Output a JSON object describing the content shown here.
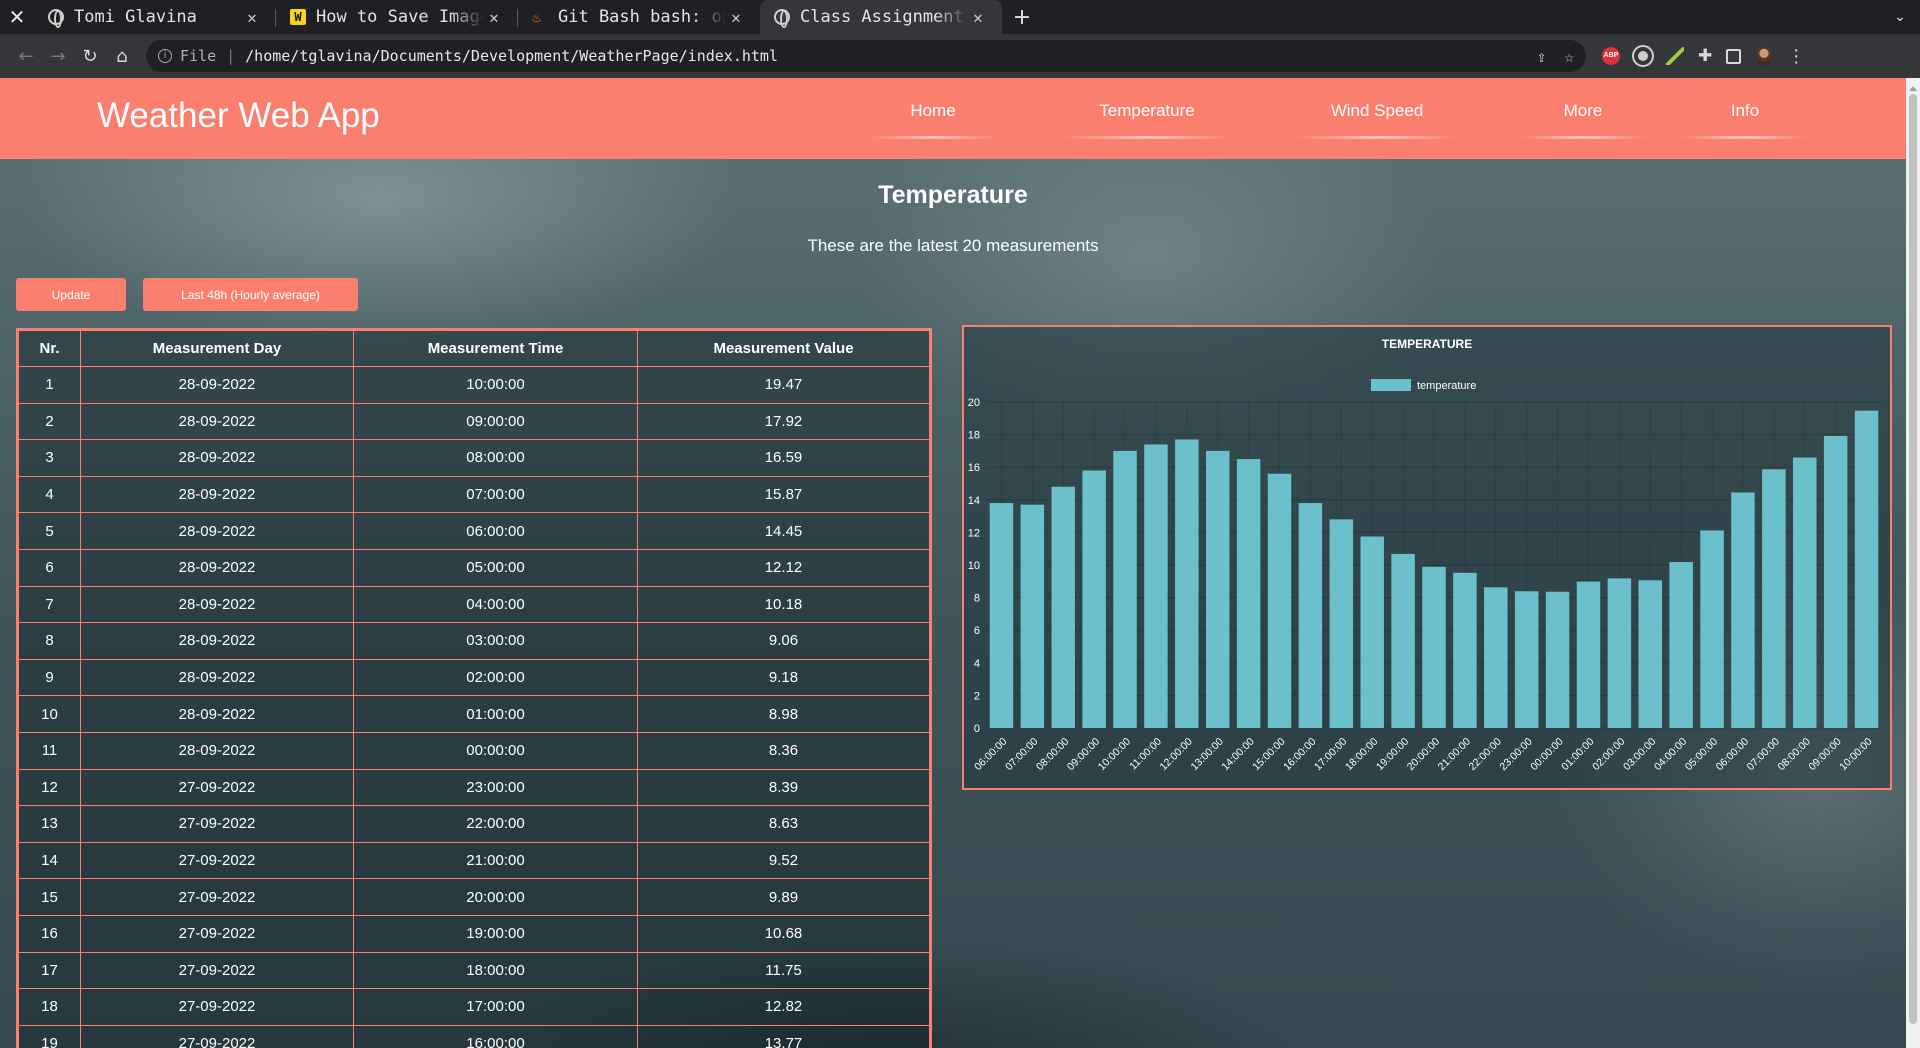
{
  "browser": {
    "tabs": [
      {
        "title": "Tomi Glavina",
        "icon": "globe-icon",
        "active": false
      },
      {
        "title": "How to Save Images",
        "icon": "w-favicon-icon",
        "active": false
      },
      {
        "title": "Git Bash bash: ope",
        "icon": "git-bash-icon",
        "active": false
      },
      {
        "title": "Class Assignment",
        "icon": "globe-icon",
        "active": true
      }
    ],
    "scheme": "File",
    "url": "/home/tglavina/Documents/Development/WeatherPage/index.html"
  },
  "header": {
    "brand": "Weather Web App",
    "nav": [
      "Home",
      "Temperature",
      "Wind Speed",
      "More",
      "Info"
    ]
  },
  "main": {
    "title": "Temperature",
    "subtitle": "These are the latest 20 measurements",
    "buttons": {
      "update": "Update",
      "last48": "Last 48h (Hourly average)"
    }
  },
  "table": {
    "headers": [
      "Nr.",
      "Measurement Day",
      "Measurement Time",
      "Measurement Value"
    ],
    "rows": [
      [
        "1",
        "28-09-2022",
        "10:00:00",
        "19.47"
      ],
      [
        "2",
        "28-09-2022",
        "09:00:00",
        "17.92"
      ],
      [
        "3",
        "28-09-2022",
        "08:00:00",
        "16.59"
      ],
      [
        "4",
        "28-09-2022",
        "07:00:00",
        "15.87"
      ],
      [
        "5",
        "28-09-2022",
        "06:00:00",
        "14.45"
      ],
      [
        "6",
        "28-09-2022",
        "05:00:00",
        "12.12"
      ],
      [
        "7",
        "28-09-2022",
        "04:00:00",
        "10.18"
      ],
      [
        "8",
        "28-09-2022",
        "03:00:00",
        "9.06"
      ],
      [
        "9",
        "28-09-2022",
        "02:00:00",
        "9.18"
      ],
      [
        "10",
        "28-09-2022",
        "01:00:00",
        "8.98"
      ],
      [
        "11",
        "28-09-2022",
        "00:00:00",
        "8.36"
      ],
      [
        "12",
        "27-09-2022",
        "23:00:00",
        "8.39"
      ],
      [
        "13",
        "27-09-2022",
        "22:00:00",
        "8.63"
      ],
      [
        "14",
        "27-09-2022",
        "21:00:00",
        "9.52"
      ],
      [
        "15",
        "27-09-2022",
        "20:00:00",
        "9.89"
      ],
      [
        "16",
        "27-09-2022",
        "19:00:00",
        "10.68"
      ],
      [
        "17",
        "27-09-2022",
        "18:00:00",
        "11.75"
      ],
      [
        "18",
        "27-09-2022",
        "17:00:00",
        "12.82"
      ],
      [
        "19",
        "27-09-2022",
        "16:00:00",
        "13.77"
      ]
    ]
  },
  "colors": {
    "accent": "#fa7f6e",
    "bar": "#6cc0cc"
  },
  "chart_data": {
    "type": "bar",
    "title": "TEMPERATURE",
    "legend": "temperature",
    "legend_position": "top",
    "ylim": [
      0,
      20
    ],
    "yticks": [
      0,
      2,
      4,
      6,
      8,
      10,
      12,
      14,
      16,
      18,
      20
    ],
    "grid": true,
    "categories": [
      "06:00:00",
      "07:00:00",
      "08:00:00",
      "09:00:00",
      "10:00:00",
      "11:00:00",
      "12:00:00",
      "13:00:00",
      "14:00:00",
      "15:00:00",
      "16:00:00",
      "17:00:00",
      "18:00:00",
      "19:00:00",
      "20:00:00",
      "21:00:00",
      "22:00:00",
      "23:00:00",
      "00:00:00",
      "01:00:00",
      "02:00:00",
      "03:00:00",
      "04:00:00",
      "05:00:00",
      "06:00:00",
      "07:00:00",
      "08:00:00",
      "09:00:00",
      "10:00:00"
    ],
    "values": [
      13.8,
      13.7,
      14.8,
      15.8,
      17.0,
      17.4,
      17.7,
      17.0,
      16.5,
      15.6,
      13.8,
      12.8,
      11.75,
      10.68,
      9.89,
      9.52,
      8.63,
      8.39,
      8.36,
      8.98,
      9.18,
      9.06,
      10.18,
      12.12,
      14.45,
      15.87,
      16.59,
      17.92,
      19.47
    ]
  }
}
